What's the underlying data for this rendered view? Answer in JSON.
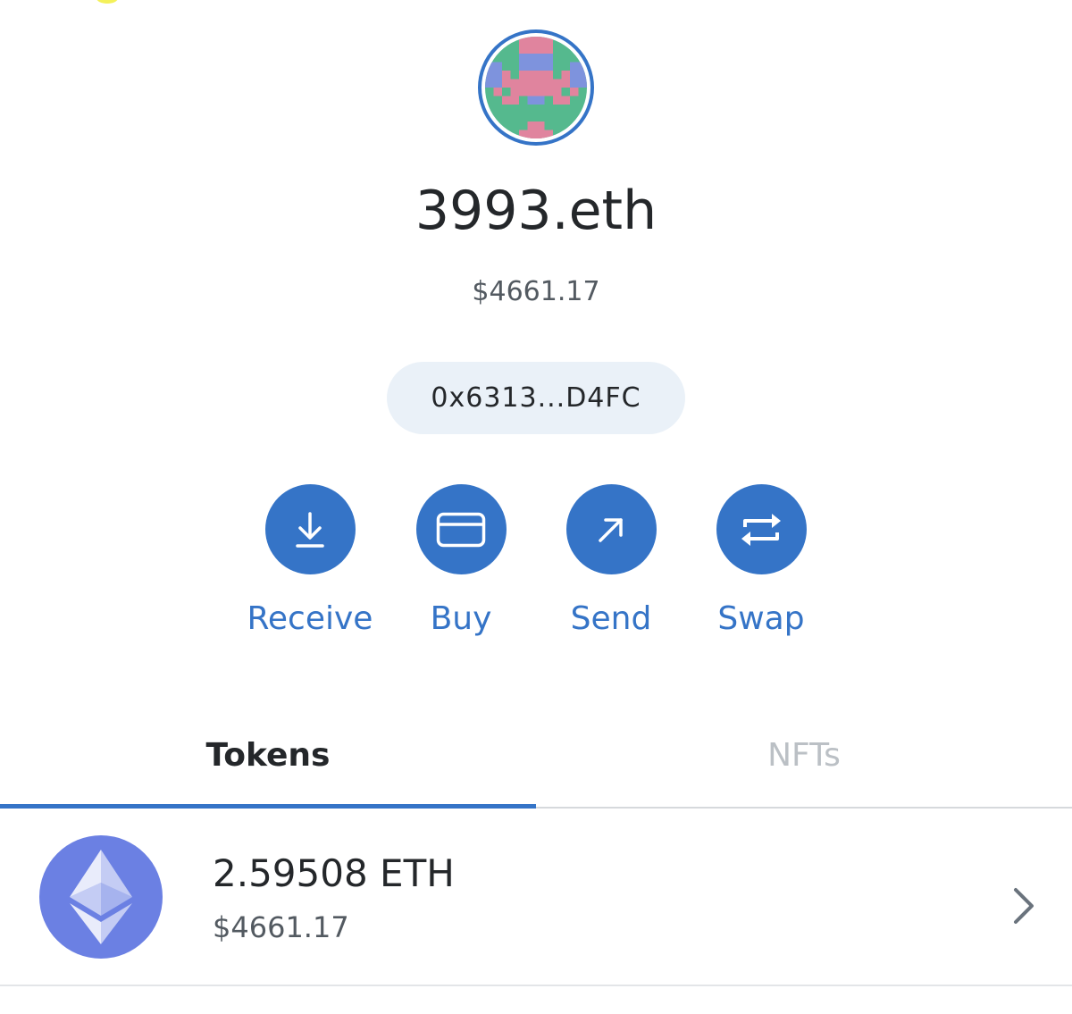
{
  "account": {
    "name": "3993.eth",
    "balance": "$4661.17",
    "address": "0x6313...D4FC"
  },
  "actions": [
    {
      "label": "Receive",
      "icon": "receive-icon"
    },
    {
      "label": "Buy",
      "icon": "card-icon"
    },
    {
      "label": "Send",
      "icon": "send-arrow-icon"
    },
    {
      "label": "Swap",
      "icon": "swap-icon"
    }
  ],
  "tabs": [
    {
      "label": "Tokens",
      "active": true
    },
    {
      "label": "NFTs",
      "active": false
    }
  ],
  "tokens": [
    {
      "amount": "2.59508 ETH",
      "fiat": "$4661.17",
      "icon": "ethereum-icon"
    }
  ],
  "colors": {
    "accent": "#3574c7",
    "text_primary": "#24272a",
    "text_secondary": "#535a61",
    "tab_inactive": "#bbc0c5",
    "address_pill_bg": "#eaf1f8",
    "eth_icon_bg": "#6b80e3",
    "avatar_green": "#55b98e",
    "avatar_pink": "#e0849e",
    "avatar_blue": "#7e93dd"
  }
}
